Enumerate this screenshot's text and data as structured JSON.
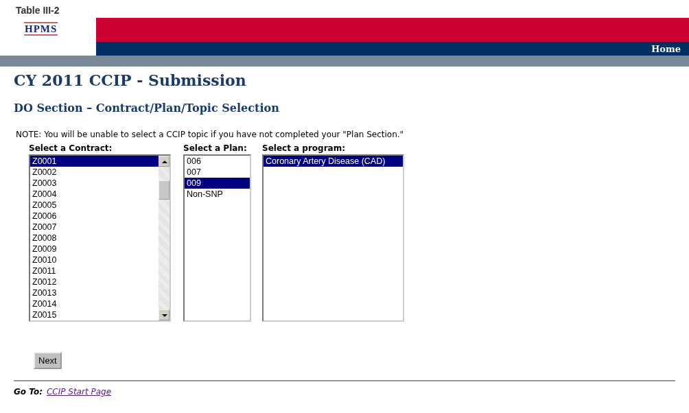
{
  "header": {
    "caption": "Table III-2",
    "logo": "HPMS",
    "nav": [
      {
        "label": "Home"
      }
    ]
  },
  "title": "CY 2011 CCIP - Submission",
  "subtitle": "DO Section – Contract/Plan/Topic Selection",
  "note": "NOTE: You will be unable to select a CCIP topic if you have not completed your \"Plan Section.\"",
  "lists": [
    {
      "label": "Select a Contract:",
      "kind": "contract",
      "scrollbar": true,
      "items": [
        {
          "text": "Z0001",
          "selected": true
        },
        {
          "text": "Z0002",
          "selected": false
        },
        {
          "text": "Z0003",
          "selected": false
        },
        {
          "text": "Z0004",
          "selected": false
        },
        {
          "text": "Z0005",
          "selected": false
        },
        {
          "text": "Z0006",
          "selected": false
        },
        {
          "text": "Z0007",
          "selected": false
        },
        {
          "text": "Z0008",
          "selected": false
        },
        {
          "text": "Z0009",
          "selected": false
        },
        {
          "text": "Z0010",
          "selected": false
        },
        {
          "text": "Z0011",
          "selected": false
        },
        {
          "text": "Z0012",
          "selected": false
        },
        {
          "text": "Z0013",
          "selected": false
        },
        {
          "text": "Z0014",
          "selected": false
        },
        {
          "text": "Z0015",
          "selected": false
        }
      ]
    },
    {
      "label": "Select a Plan:",
      "kind": "plan",
      "scrollbar": false,
      "items": [
        {
          "text": "006",
          "selected": false
        },
        {
          "text": "007",
          "selected": false
        },
        {
          "text": "009",
          "selected": true
        },
        {
          "text": "Non-SNP",
          "selected": false
        }
      ]
    },
    {
      "label": "Select a program:",
      "kind": "program",
      "scrollbar": false,
      "items": [
        {
          "text": "Coronary Artery Disease (CAD)",
          "selected": true
        }
      ]
    }
  ],
  "button": "Next",
  "footer": {
    "label": "Go To:",
    "link": "CCIP Start Page"
  }
}
